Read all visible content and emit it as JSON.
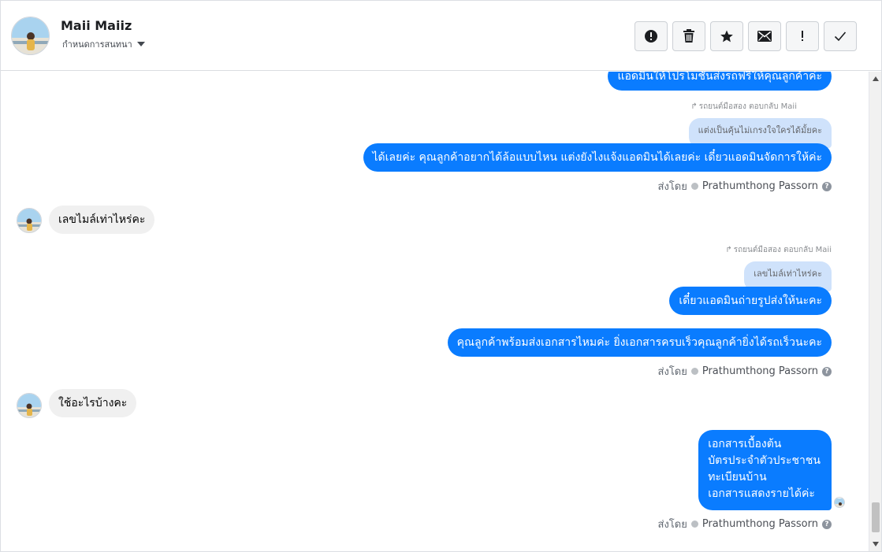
{
  "header": {
    "contact_name": "Maii Maiiz",
    "contact_sub": "กำหนดการสนทนา",
    "toolbar": [
      {
        "name": "spam-button",
        "icon": "alert-circle-icon"
      },
      {
        "name": "delete-button",
        "icon": "trash-icon"
      },
      {
        "name": "star-button",
        "icon": "star-icon"
      },
      {
        "name": "mark-unread-button",
        "icon": "envelope-icon"
      },
      {
        "name": "important-button",
        "icon": "exclamation-icon"
      },
      {
        "name": "mark-done-button",
        "icon": "checkmark-icon"
      }
    ]
  },
  "thread": {
    "msg_top_partial": "แอดมินให้โปรโมชั่นส่งรถฟรีให้คุณลูกค้าค่ะ",
    "reply1_note": "รถยนต์มือสอง ตอบกลับ Maii",
    "reply1_quote": "แต่งเป็นคุ้นไม่เกรงใจใครได้มั้ยคะ",
    "msg_out_1": "ได้เลยค่ะ คุณลูกค้าอยากได้ล้อแบบไหน แต่งยังไงแจ้งแอดมินได้เลยค่ะ เดี๋ยวแอดมินจัดการให้ค่ะ",
    "sent_by_label": "ส่งโดย",
    "sender_name": "Prathumthong Passorn",
    "msg_in_1": "เลขไมล์เท่าไหร่คะ",
    "reply2_note": "รถยนต์มือสอง ตอบกลับ Maii",
    "reply2_quote": "เลขไมล์เท่าไหร่คะ",
    "msg_out_2": "เดี๋ยวแอดมินถ่ายรูปส่งให้นะคะ",
    "msg_out_3": "คุณลูกค้าพร้อมส่งเอกสารไหมค่ะ ยิ่งเอกสารครบเร็วคุณลูกค้ายิ่งได้รถเร็วนะคะ",
    "msg_in_2": "ใช้อะไรบ้างคะ",
    "msg_out_4_lines": [
      "เอกสารเบื้องต้น",
      "บัตรประจำตัวประชาชน",
      "ทะเบียนบ้าน",
      "เอกสารแสดงรายได้ค่ะ"
    ]
  },
  "colors": {
    "outgoing_bubble": "#0a7cff",
    "incoming_bubble": "#f0f0f0",
    "reply_quote": "#cfe2fb"
  }
}
